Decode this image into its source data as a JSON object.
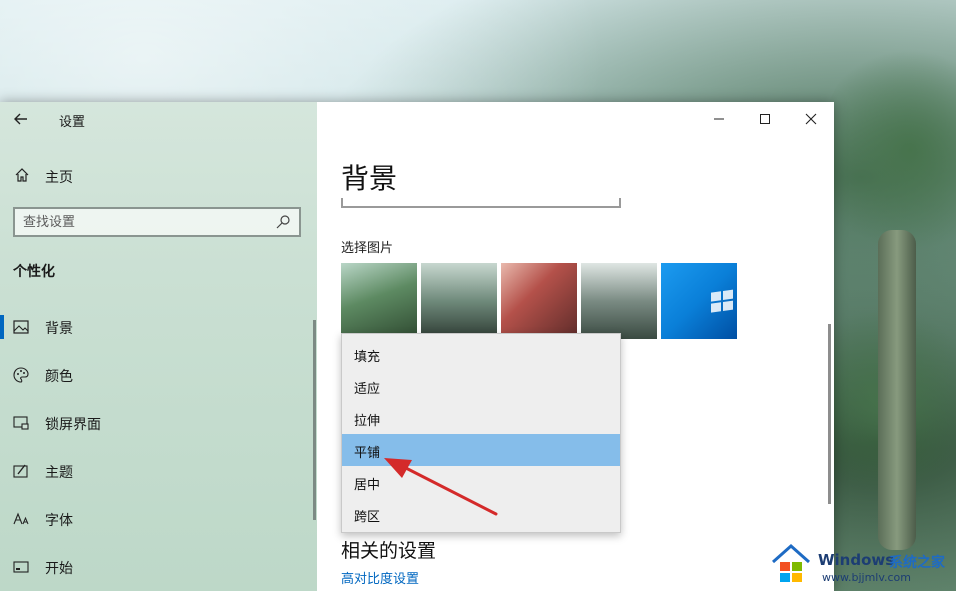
{
  "window": {
    "app_title": "设置"
  },
  "sidebar": {
    "home_label": "主页",
    "search_placeholder": "查找设置",
    "section_label": "个性化",
    "items": [
      {
        "label": "背景",
        "icon": "image-icon",
        "active": true
      },
      {
        "label": "颜色",
        "icon": "palette-icon",
        "active": false
      },
      {
        "label": "锁屏界面",
        "icon": "lock-screen-icon",
        "active": false
      },
      {
        "label": "主题",
        "icon": "theme-icon",
        "active": false
      },
      {
        "label": "字体",
        "icon": "font-icon",
        "active": false
      },
      {
        "label": "开始",
        "icon": "start-icon",
        "active": false
      }
    ]
  },
  "content": {
    "page_title": "背景",
    "choose_picture_label": "选择图片",
    "fit_options": [
      "填充",
      "适应",
      "拉伸",
      "平铺",
      "居中",
      "跨区"
    ],
    "selected_fit": "平铺",
    "related_title": "相关的设置",
    "related_link": "高对比度设置"
  },
  "watermark": {
    "title": "Windows",
    "subtitle": "系统之家",
    "url": "www.bjjmlv.com"
  },
  "colors": {
    "accent": "#0067c0",
    "selected_option": "#85bdea",
    "arrow": "#d42a2a"
  }
}
